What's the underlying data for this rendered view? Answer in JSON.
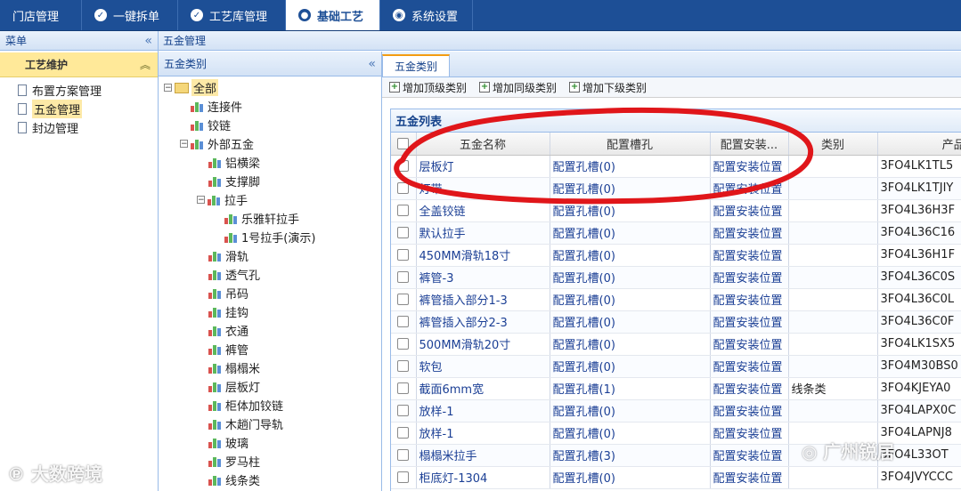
{
  "nav": {
    "tabs": [
      {
        "label": "门店管理"
      },
      {
        "label": "一键拆单"
      },
      {
        "label": "工艺库管理"
      },
      {
        "label": "基础工艺"
      },
      {
        "label": "系统设置"
      }
    ]
  },
  "menu": {
    "title": "菜单",
    "collapse_glyph": "«",
    "group": "工艺维护",
    "group_glyph": "︽",
    "items": [
      {
        "label": "布置方案管理"
      },
      {
        "label": "五金管理"
      },
      {
        "label": "封边管理"
      }
    ]
  },
  "breadcrumb": "五金管理",
  "tree": {
    "title": "五金类别",
    "collapse_glyph": "«",
    "root": "全部",
    "nodes": [
      {
        "label": "连接件"
      },
      {
        "label": "铰链"
      },
      {
        "label": "外部五金"
      },
      {
        "label": "铝横梁"
      },
      {
        "label": "支撑脚"
      },
      {
        "label": "拉手"
      },
      {
        "label": "乐雅轩拉手"
      },
      {
        "label": "1号拉手(演示)"
      },
      {
        "label": "滑轨"
      },
      {
        "label": "透气孔"
      },
      {
        "label": "吊码"
      },
      {
        "label": "挂钩"
      },
      {
        "label": "衣通"
      },
      {
        "label": "裤管"
      },
      {
        "label": "榻榻米"
      },
      {
        "label": "层板灯"
      },
      {
        "label": "柜体加铰链"
      },
      {
        "label": "木趟门导轨"
      },
      {
        "label": "玻璃"
      },
      {
        "label": "罗马柱"
      },
      {
        "label": "线条类"
      }
    ]
  },
  "content": {
    "tab": "五金类别",
    "toolbar": {
      "add_top": "增加顶级类别",
      "add_same": "增加同级类别",
      "add_sub": "增加下级类别"
    },
    "grid_title": "五金列表",
    "columns": {
      "name": "五金名称",
      "slot": "配置槽孔",
      "install": "配置安装...",
      "category": "类别",
      "product_id": "产品id"
    },
    "rows": [
      {
        "name": "层板灯",
        "slot": "配置孔槽(0)",
        "install": "配置安装位置",
        "category": "",
        "pid": "3FO4LK1TL5"
      },
      {
        "name": "灯带",
        "slot": "配置孔槽(0)",
        "install": "配置安装位置",
        "category": "",
        "pid": "3FO4LK1TJIY"
      },
      {
        "name": "全盖铰链",
        "slot": "配置孔槽(0)",
        "install": "配置安装位置",
        "category": "",
        "pid": "3FO4L36H3F"
      },
      {
        "name": "默认拉手",
        "slot": "配置孔槽(0)",
        "install": "配置安装位置",
        "category": "",
        "pid": "3FO4L36C16"
      },
      {
        "name": "450MM滑轨18寸",
        "slot": "配置孔槽(0)",
        "install": "配置安装位置",
        "category": "",
        "pid": "3FO4L36H1F"
      },
      {
        "name": "裤管-3",
        "slot": "配置孔槽(0)",
        "install": "配置安装位置",
        "category": "",
        "pid": "3FO4L36C0S"
      },
      {
        "name": "裤管插入部分1-3",
        "slot": "配置孔槽(0)",
        "install": "配置安装位置",
        "category": "",
        "pid": "3FO4L36C0L"
      },
      {
        "name": "裤管插入部分2-3",
        "slot": "配置孔槽(0)",
        "install": "配置安装位置",
        "category": "",
        "pid": "3FO4L36C0F"
      },
      {
        "name": "500MM滑轨20寸",
        "slot": "配置孔槽(0)",
        "install": "配置安装位置",
        "category": "",
        "pid": "3FO4LK1SX5"
      },
      {
        "name": "软包",
        "slot": "配置孔槽(0)",
        "install": "配置安装位置",
        "category": "",
        "pid": "3FO4M30BS0"
      },
      {
        "name": "截面6mm宽",
        "slot": "配置孔槽(1)",
        "install": "配置安装位置",
        "category": "线条类",
        "pid": "3FO4KJEYA0"
      },
      {
        "name": "放样-1",
        "slot": "配置孔槽(0)",
        "install": "配置安装位置",
        "category": "",
        "pid": "3FO4LAPX0C"
      },
      {
        "name": "放样-1",
        "slot": "配置孔槽(0)",
        "install": "配置安装位置",
        "category": "",
        "pid": "3FO4LAPNJ8"
      },
      {
        "name": "榻榻米拉手",
        "slot": "配置孔槽(3)",
        "install": "配置安装位置",
        "category": "",
        "pid": "3FO4L33OT"
      },
      {
        "name": "柜底灯-1304",
        "slot": "配置孔槽(0)",
        "install": "配置安装位置",
        "category": "",
        "pid": "3FO4JVYCCC"
      }
    ]
  },
  "watermarks": {
    "left": "大数跨境",
    "right": "广州锐居"
  },
  "colors": {
    "nav_bg": "#1d4f96",
    "accent_tab": "#f39c12",
    "highlight": "#fde9a7",
    "annotation": "#e0161a"
  }
}
